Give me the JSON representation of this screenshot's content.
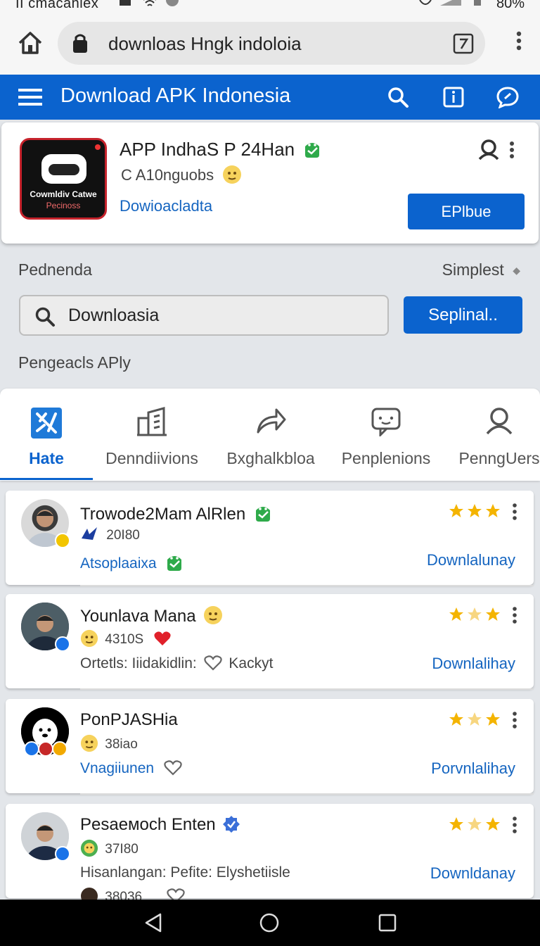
{
  "status": {
    "left": "II cmacaniex",
    "battery": "80%"
  },
  "browser": {
    "url": "downloas Hngk indoloia"
  },
  "appbar": {
    "title": "Download APK Indonesia"
  },
  "featured": {
    "logo_line1": "Cowmldiv Catwe",
    "logo_line2": "Pecinoss",
    "name": "APP IndhaS P 24Han",
    "subtitle": "C A10nguobs",
    "link": "Dowioacladta",
    "button": "EPlbue"
  },
  "search": {
    "left_label": "Pednenda",
    "right_label": "Simplest",
    "query": "Downloasia",
    "button": "Seplinal..",
    "section_label": "Pengeacls APly"
  },
  "tabs": [
    {
      "label": "Hate",
      "icon": "star-grid-icon",
      "active": true
    },
    {
      "label": "Denndiivions",
      "icon": "building-icon"
    },
    {
      "label": "Bxghalkbloa",
      "icon": "share-arrow-icon"
    },
    {
      "label": "Penplenions",
      "icon": "chat-bubble-icon"
    },
    {
      "label": "PenngUers",
      "icon": "user-icon"
    }
  ],
  "colors": {
    "accent": "#0b63ce",
    "link": "#1565c0",
    "star": "#f4b400",
    "android": "#2eaa4a"
  },
  "list": [
    {
      "name": "Trowode2Mam AlRlen",
      "meta": "20I80",
      "sub": "Atsoplaaixa",
      "download": "Downlalunay",
      "rating": 3
    },
    {
      "name": "Younlava Mana",
      "meta": "4310S",
      "sub": "Ortetls: Iiidakidlin:",
      "sub2": "Kackyt",
      "download": "Downlalihay",
      "rating": 2.5
    },
    {
      "name": "PonPJASHia",
      "meta": "38iao",
      "sub": "Vnagiiunen",
      "download": "Porvnlalihay",
      "rating": 2.5
    },
    {
      "name": "Pesaeмoch Enten",
      "meta": "37I80",
      "sub": "Hisanlangan: Pefite: Elyshetiisle",
      "download": "Downldanay",
      "rating": 2.5,
      "extra": "38036"
    }
  ]
}
